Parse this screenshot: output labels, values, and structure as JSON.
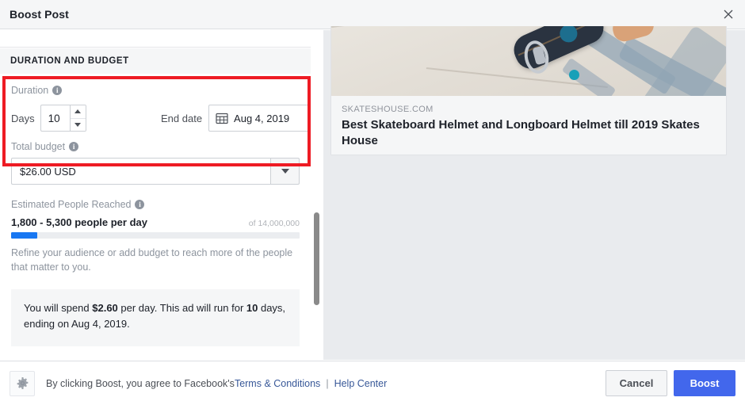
{
  "window": {
    "title": "Boost Post",
    "close_icon": "close-icon"
  },
  "section": {
    "header": "DURATION AND BUDGET"
  },
  "duration": {
    "label": "Duration",
    "info_icon": "info-icon",
    "days_label": "Days",
    "days_value": "10",
    "spinner_up_icon": "triangle-up-icon",
    "spinner_down_icon": "triangle-down-icon",
    "end_date_label": "End date",
    "end_date_value": "Aug 4, 2019",
    "calendar_icon": "calendar-icon"
  },
  "budget": {
    "label": "Total budget",
    "info_icon": "info-icon",
    "value": "$26.00 USD",
    "dropdown_icon": "chevron-down-icon"
  },
  "reach": {
    "label": "Estimated People Reached",
    "info_icon": "info-icon",
    "range": "1,800 - 5,300 people per day",
    "total": "of 14,000,000",
    "progress_percent": 9,
    "progress_color": "#1877f2",
    "refine_text": "Refine your audience or add budget to reach more of the people that matter to you."
  },
  "spend_summary": {
    "prefix": "You will spend ",
    "amount": "$2.60",
    "middle": " per day. This ad will run for ",
    "days": "10",
    "suffix": " days, ending on Aug 4, 2019."
  },
  "preview": {
    "domain": "SKATESHOUSE.COM",
    "title": "Best Skateboard Helmet and Longboard Helmet till 2019 Skates House",
    "image_alt": "skateboard-overhead-photo"
  },
  "footer": {
    "gear_icon": "gear-icon",
    "agreement_prefix": "By clicking Boost, you agree to Facebook's ",
    "terms_link": "Terms & Conditions",
    "separator": "|",
    "help_link": "Help Center",
    "cancel_label": "Cancel",
    "boost_label": "Boost",
    "boost_color": "#4267ec"
  },
  "highlight": {
    "color": "#ee1b24"
  }
}
